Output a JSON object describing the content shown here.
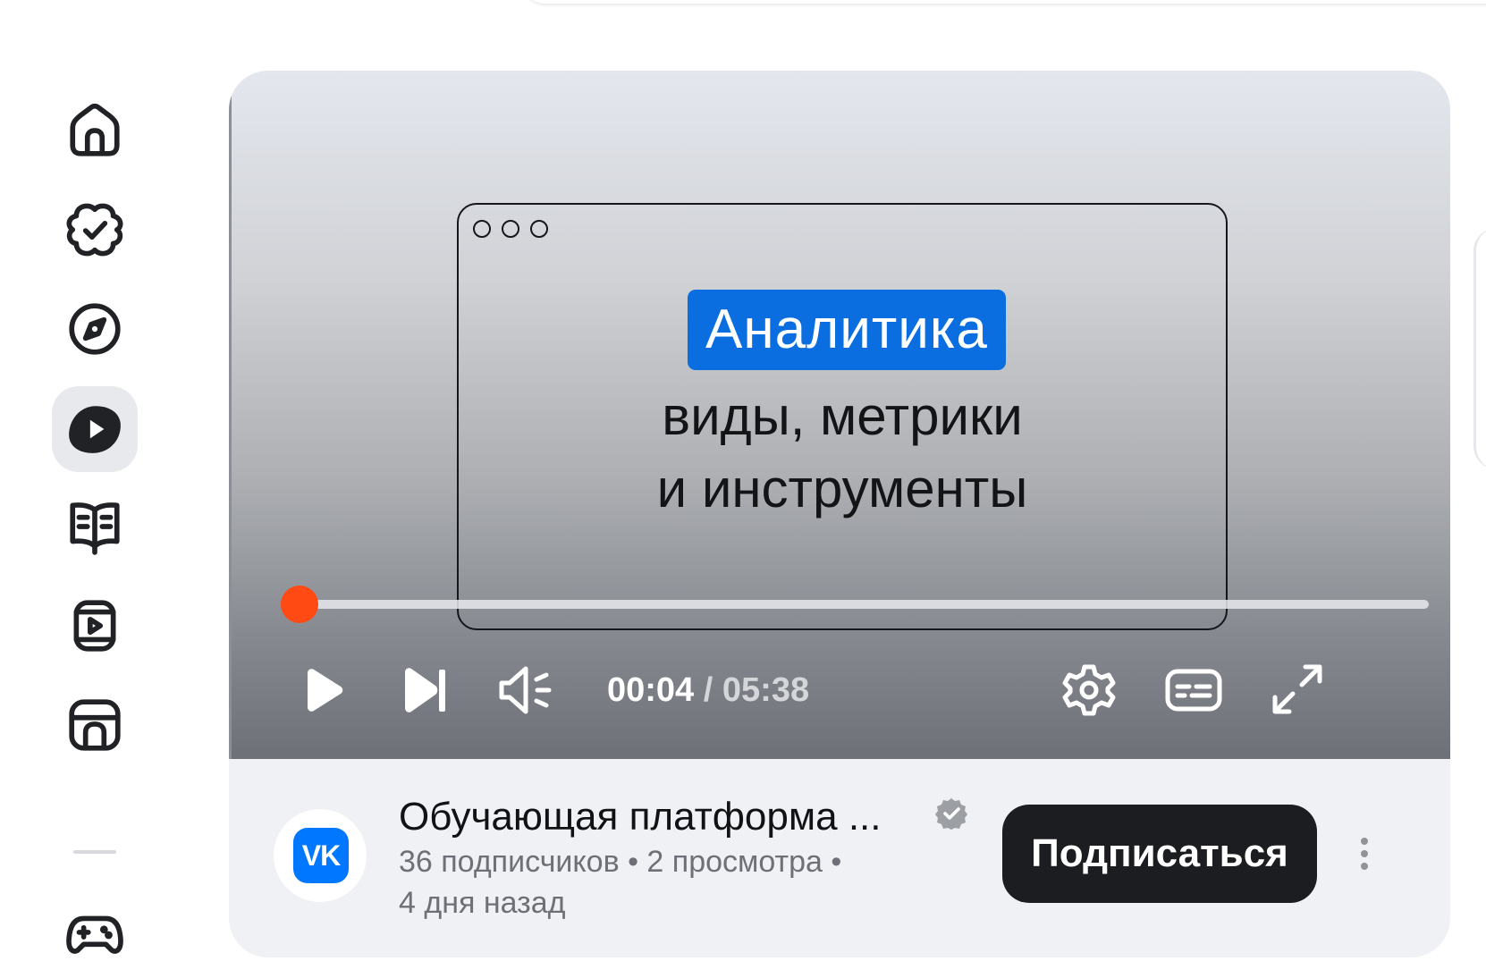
{
  "sidebar": {
    "items": [
      {
        "icon": "home-icon"
      },
      {
        "icon": "services-icon"
      },
      {
        "icon": "compass-icon"
      },
      {
        "icon": "video-icon",
        "active": true
      },
      {
        "icon": "book-icon"
      },
      {
        "icon": "clips-icon"
      },
      {
        "icon": "store-icon"
      },
      {
        "icon": "gamepad-icon"
      }
    ]
  },
  "player": {
    "slide": {
      "badge": "Аналитика",
      "line1": "виды, метрики",
      "line2": "и инструменты"
    },
    "progress": 0.012,
    "time_current": "00:04",
    "time_separator": " / ",
    "time_duration": "05:38"
  },
  "info": {
    "channel_title": "Обучающая платформа ...",
    "meta_line1": "36 подписчиков • 2 просмотра •",
    "meta_line2": "4 дня назад",
    "subscribe_label": "Подписаться",
    "avatar_text": "VK"
  },
  "colors": {
    "accent": "#0a6ee0",
    "progress": "#ff5722",
    "vk_blue": "#0077ff",
    "button_dark": "#1c1d20"
  }
}
